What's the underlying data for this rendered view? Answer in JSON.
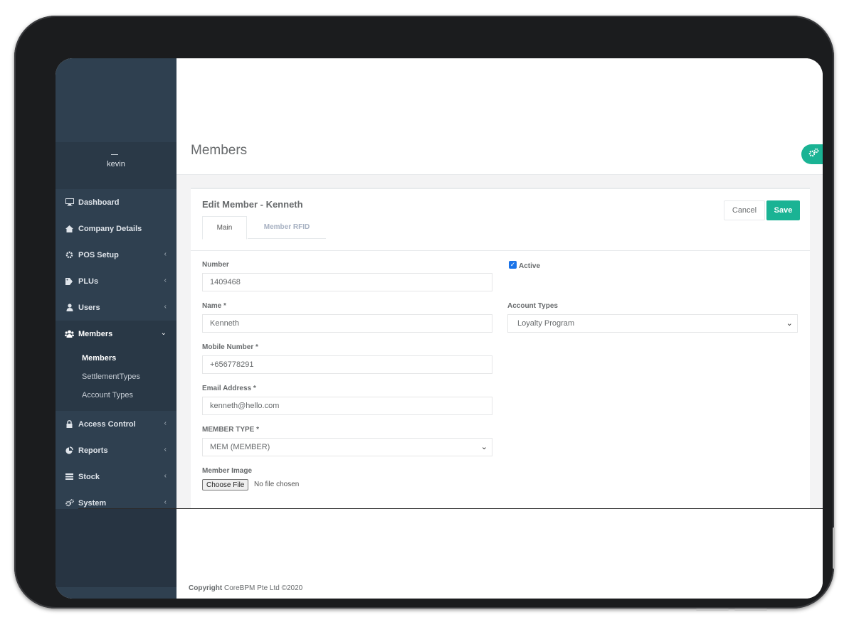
{
  "sidebar": {
    "username": "kevin",
    "items": [
      {
        "label": "Dashboard",
        "icon": "monitor-icon"
      },
      {
        "label": "Company Details",
        "icon": "home-icon"
      },
      {
        "label": "POS Setup",
        "icon": "gear-icon"
      },
      {
        "label": "PLUs",
        "icon": "tags-icon"
      },
      {
        "label": "Users",
        "icon": "user-icon"
      },
      {
        "label": "Members",
        "icon": "users-icon"
      },
      {
        "label": "Access Control",
        "icon": "lock-icon"
      },
      {
        "label": "Reports",
        "icon": "pie-chart-icon"
      },
      {
        "label": "Stock",
        "icon": "list-icon"
      },
      {
        "label": "System",
        "icon": "gears-icon"
      }
    ],
    "members_submenu": [
      "Members",
      "SettlementTypes",
      "Account Types"
    ]
  },
  "page": {
    "title": "Members"
  },
  "form": {
    "title": "Edit Member - Kenneth",
    "cancel_label": "Cancel",
    "save_label": "Save",
    "tabs": [
      "Main",
      "Member RFID"
    ],
    "number_label": "Number",
    "number_value": "1409468",
    "name_label": "Name *",
    "name_value": "Kenneth",
    "mobile_label": "Mobile Number *",
    "mobile_value": "+656778291",
    "email_label": "Email Address *",
    "email_value": "kenneth@hello.com",
    "member_type_label": "MEMBER TYPE *",
    "member_type_value": "MEM (MEMBER)",
    "member_image_label": "Member Image",
    "choose_file_label": "Choose File",
    "file_status": "No file chosen",
    "active_label": "Active",
    "active_checked": true,
    "account_types_label": "Account Types",
    "account_types_value": "Loyalty Program"
  },
  "footer": {
    "copyright_label": "Copyright",
    "copyright_text": "CoreBPM Pte Ltd ©2020"
  },
  "colors": {
    "sidebar": "#2f4050",
    "accent": "#1ab394",
    "checkbox": "#1a73e8"
  }
}
